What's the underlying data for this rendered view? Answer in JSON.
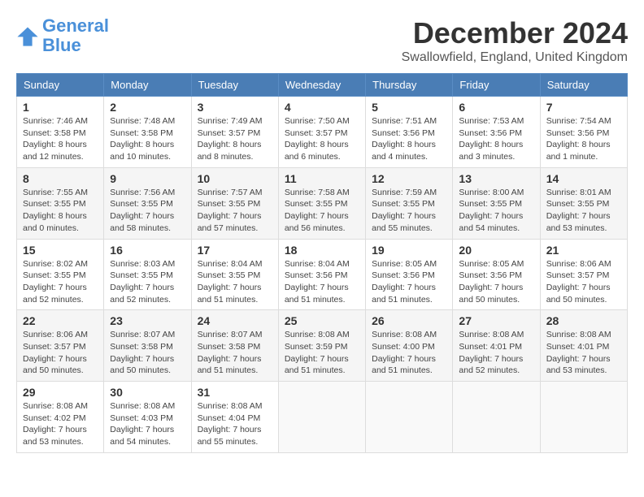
{
  "logo": {
    "text_general": "General",
    "text_blue": "Blue"
  },
  "header": {
    "month": "December 2024",
    "location": "Swallowfield, England, United Kingdom"
  },
  "weekdays": [
    "Sunday",
    "Monday",
    "Tuesday",
    "Wednesday",
    "Thursday",
    "Friday",
    "Saturday"
  ],
  "weeks": [
    [
      {
        "day": "1",
        "info": "Sunrise: 7:46 AM\nSunset: 3:58 PM\nDaylight: 8 hours\nand 12 minutes."
      },
      {
        "day": "2",
        "info": "Sunrise: 7:48 AM\nSunset: 3:58 PM\nDaylight: 8 hours\nand 10 minutes."
      },
      {
        "day": "3",
        "info": "Sunrise: 7:49 AM\nSunset: 3:57 PM\nDaylight: 8 hours\nand 8 minutes."
      },
      {
        "day": "4",
        "info": "Sunrise: 7:50 AM\nSunset: 3:57 PM\nDaylight: 8 hours\nand 6 minutes."
      },
      {
        "day": "5",
        "info": "Sunrise: 7:51 AM\nSunset: 3:56 PM\nDaylight: 8 hours\nand 4 minutes."
      },
      {
        "day": "6",
        "info": "Sunrise: 7:53 AM\nSunset: 3:56 PM\nDaylight: 8 hours\nand 3 minutes."
      },
      {
        "day": "7",
        "info": "Sunrise: 7:54 AM\nSunset: 3:56 PM\nDaylight: 8 hours\nand 1 minute."
      }
    ],
    [
      {
        "day": "8",
        "info": "Sunrise: 7:55 AM\nSunset: 3:55 PM\nDaylight: 8 hours\nand 0 minutes."
      },
      {
        "day": "9",
        "info": "Sunrise: 7:56 AM\nSunset: 3:55 PM\nDaylight: 7 hours\nand 58 minutes."
      },
      {
        "day": "10",
        "info": "Sunrise: 7:57 AM\nSunset: 3:55 PM\nDaylight: 7 hours\nand 57 minutes."
      },
      {
        "day": "11",
        "info": "Sunrise: 7:58 AM\nSunset: 3:55 PM\nDaylight: 7 hours\nand 56 minutes."
      },
      {
        "day": "12",
        "info": "Sunrise: 7:59 AM\nSunset: 3:55 PM\nDaylight: 7 hours\nand 55 minutes."
      },
      {
        "day": "13",
        "info": "Sunrise: 8:00 AM\nSunset: 3:55 PM\nDaylight: 7 hours\nand 54 minutes."
      },
      {
        "day": "14",
        "info": "Sunrise: 8:01 AM\nSunset: 3:55 PM\nDaylight: 7 hours\nand 53 minutes."
      }
    ],
    [
      {
        "day": "15",
        "info": "Sunrise: 8:02 AM\nSunset: 3:55 PM\nDaylight: 7 hours\nand 52 minutes."
      },
      {
        "day": "16",
        "info": "Sunrise: 8:03 AM\nSunset: 3:55 PM\nDaylight: 7 hours\nand 52 minutes."
      },
      {
        "day": "17",
        "info": "Sunrise: 8:04 AM\nSunset: 3:55 PM\nDaylight: 7 hours\nand 51 minutes."
      },
      {
        "day": "18",
        "info": "Sunrise: 8:04 AM\nSunset: 3:56 PM\nDaylight: 7 hours\nand 51 minutes."
      },
      {
        "day": "19",
        "info": "Sunrise: 8:05 AM\nSunset: 3:56 PM\nDaylight: 7 hours\nand 51 minutes."
      },
      {
        "day": "20",
        "info": "Sunrise: 8:05 AM\nSunset: 3:56 PM\nDaylight: 7 hours\nand 50 minutes."
      },
      {
        "day": "21",
        "info": "Sunrise: 8:06 AM\nSunset: 3:57 PM\nDaylight: 7 hours\nand 50 minutes."
      }
    ],
    [
      {
        "day": "22",
        "info": "Sunrise: 8:06 AM\nSunset: 3:57 PM\nDaylight: 7 hours\nand 50 minutes."
      },
      {
        "day": "23",
        "info": "Sunrise: 8:07 AM\nSunset: 3:58 PM\nDaylight: 7 hours\nand 50 minutes."
      },
      {
        "day": "24",
        "info": "Sunrise: 8:07 AM\nSunset: 3:58 PM\nDaylight: 7 hours\nand 51 minutes."
      },
      {
        "day": "25",
        "info": "Sunrise: 8:08 AM\nSunset: 3:59 PM\nDaylight: 7 hours\nand 51 minutes."
      },
      {
        "day": "26",
        "info": "Sunrise: 8:08 AM\nSunset: 4:00 PM\nDaylight: 7 hours\nand 51 minutes."
      },
      {
        "day": "27",
        "info": "Sunrise: 8:08 AM\nSunset: 4:01 PM\nDaylight: 7 hours\nand 52 minutes."
      },
      {
        "day": "28",
        "info": "Sunrise: 8:08 AM\nSunset: 4:01 PM\nDaylight: 7 hours\nand 53 minutes."
      }
    ],
    [
      {
        "day": "29",
        "info": "Sunrise: 8:08 AM\nSunset: 4:02 PM\nDaylight: 7 hours\nand 53 minutes."
      },
      {
        "day": "30",
        "info": "Sunrise: 8:08 AM\nSunset: 4:03 PM\nDaylight: 7 hours\nand 54 minutes."
      },
      {
        "day": "31",
        "info": "Sunrise: 8:08 AM\nSunset: 4:04 PM\nDaylight: 7 hours\nand 55 minutes."
      },
      {
        "day": "",
        "info": ""
      },
      {
        "day": "",
        "info": ""
      },
      {
        "day": "",
        "info": ""
      },
      {
        "day": "",
        "info": ""
      }
    ]
  ]
}
